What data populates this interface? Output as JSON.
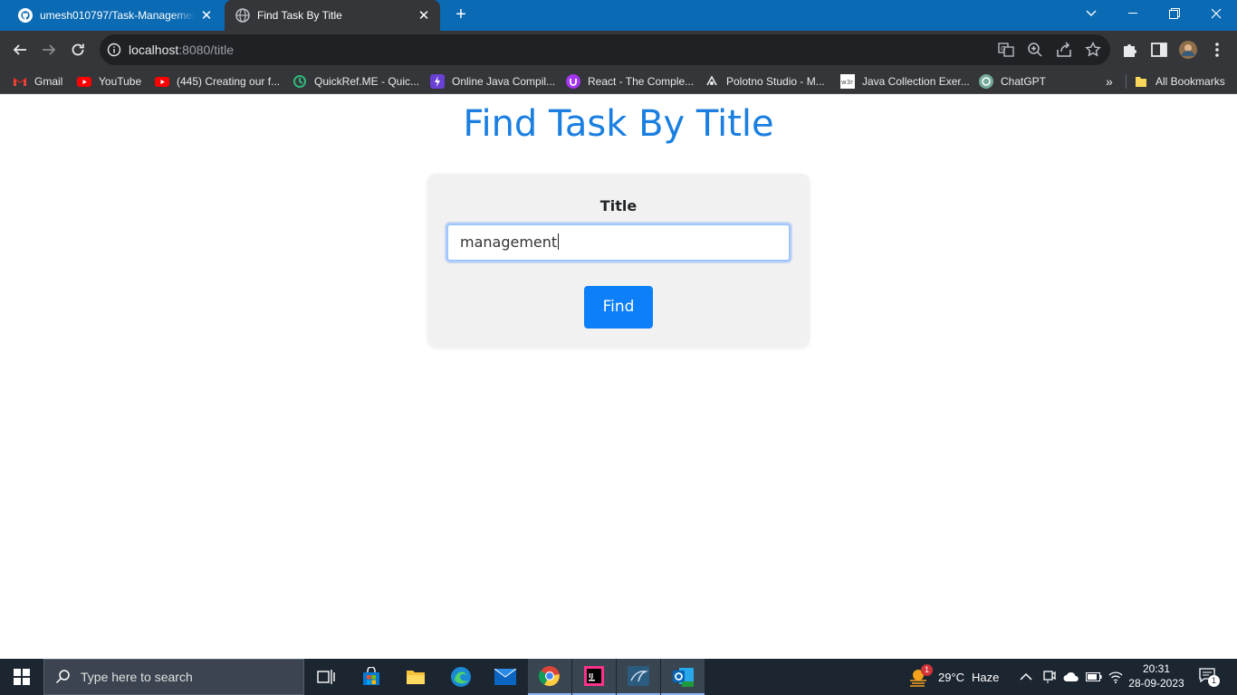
{
  "browser": {
    "tabs": [
      {
        "title": "umesh010797/Task-Management",
        "active": false,
        "icon": "github-icon"
      },
      {
        "title": "Find Task By Title",
        "active": true,
        "icon": "globe-icon"
      }
    ],
    "url_host": "localhost",
    "url_rest": ":8080/title",
    "bookmarks": [
      {
        "label": "Gmail",
        "icon": "gmail-icon"
      },
      {
        "label": "YouTube",
        "icon": "youtube-icon"
      },
      {
        "label": "(445) Creating our f...",
        "icon": "youtube-icon"
      },
      {
        "label": "QuickRef.ME - Quic...",
        "icon": "quickref-icon"
      },
      {
        "label": "Online Java Compil...",
        "icon": "compiler-icon"
      },
      {
        "label": "React - The Comple...",
        "icon": "udemy-icon"
      },
      {
        "label": "Polotno Studio - M...",
        "icon": "polotno-icon"
      },
      {
        "label": "Java Collection Exer...",
        "icon": "w3r-icon"
      },
      {
        "label": "ChatGPT",
        "icon": "chatgpt-icon"
      }
    ],
    "all_bookmarks": "All Bookmarks"
  },
  "page": {
    "heading": "Find Task By Title",
    "form": {
      "label": "Title",
      "input_value": "management",
      "button_label": "Find"
    }
  },
  "taskbar": {
    "search_placeholder": "Type here to search",
    "weather_temp": "29°C",
    "weather_text": "Haze",
    "weather_badge": "1",
    "time": "20:31",
    "date": "28-09-2023",
    "notification_count": "1"
  },
  "colors": {
    "accent": "#1a7fe0",
    "button": "#0d7ff9",
    "tab_strip": "#0a6ab3",
    "toolbar": "#35363a",
    "taskbar": "#1c2631"
  }
}
